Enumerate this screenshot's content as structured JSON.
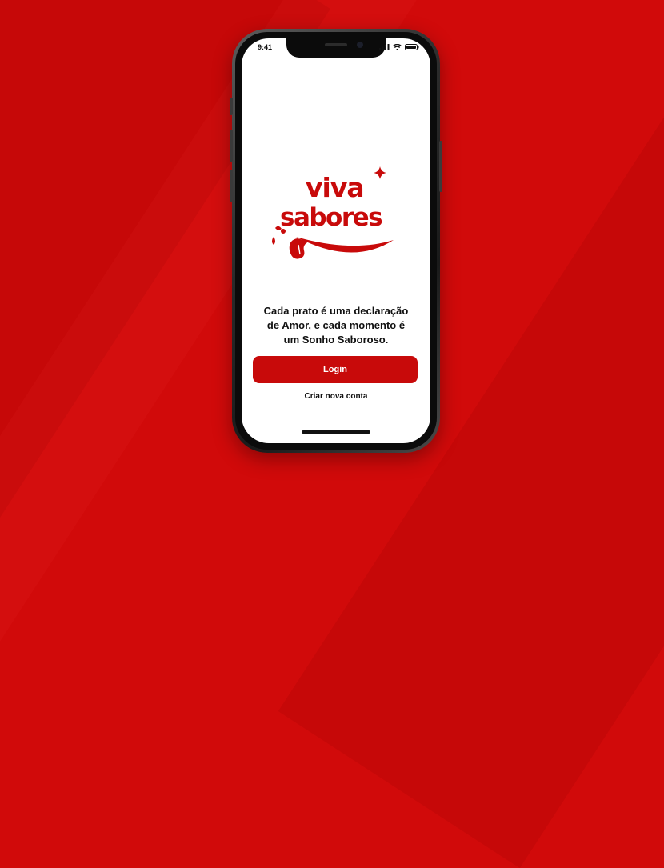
{
  "colors": {
    "brand_red": "#c80a0a",
    "background_red": "#d10a0a",
    "screen_white": "#ffffff",
    "text_dark": "#111111"
  },
  "status_bar": {
    "time": "9:41",
    "icons": [
      "cellular-signal-icon",
      "wifi-icon",
      "battery-icon"
    ]
  },
  "logo": {
    "line1": "viva",
    "line2": "sabores",
    "icons": [
      "sparkle-icon",
      "smile-tongue-icon"
    ]
  },
  "tagline": "Cada prato é uma declaração\nde Amor, e cada momento é\num Sonho Saboroso.",
  "actions": {
    "login_label": "Login",
    "create_account_label": "Criar nova conta"
  }
}
